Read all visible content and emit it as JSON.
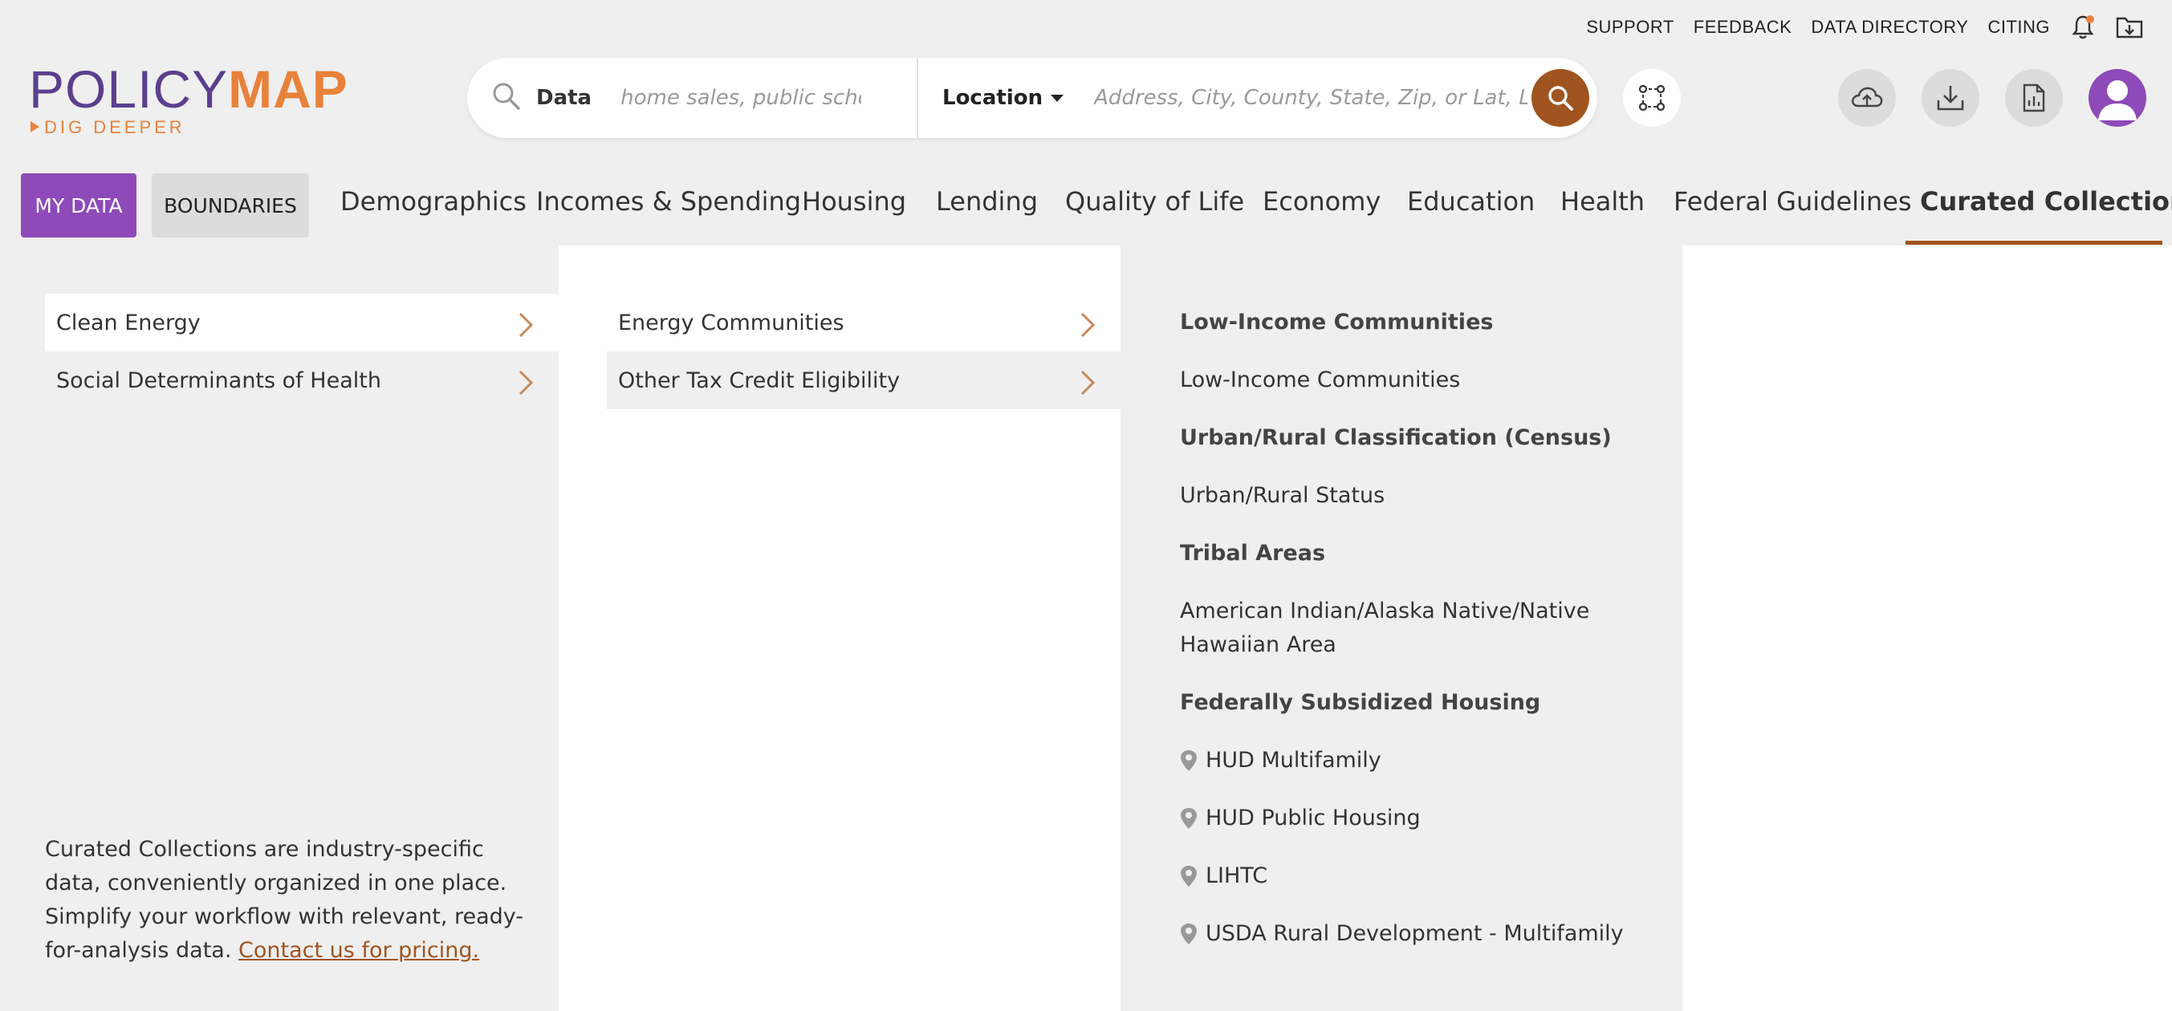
{
  "utility_links": [
    "SUPPORT",
    "FEEDBACK",
    "DATA DIRECTORY",
    "CITING"
  ],
  "logo": {
    "part1": "POLICY",
    "part2": "MAP",
    "tagline": "DIG DEEPER"
  },
  "search": {
    "data_label": "Data",
    "data_placeholder": "home sales, public school...",
    "location_label": "Location",
    "location_placeholder": "Address, City, County, State, Zip, or Lat, Long"
  },
  "nav": {
    "my_data": "MY DATA",
    "boundaries": "BOUNDARIES",
    "tabs": [
      "Demographics",
      "Incomes & Spending",
      "Housing",
      "Lending",
      "Quality of Life",
      "Economy",
      "Education",
      "Health",
      "Federal Guidelines",
      "Curated Collections"
    ],
    "active_tab": "Curated Collections"
  },
  "col1": {
    "items": [
      "Clean Energy",
      "Social Determinants of Health"
    ],
    "blurb": "Curated Collections are industry-specific data, conveniently organized in one place. Simplify your workflow with relevant, ready-for-analysis data.",
    "blurb_link": "Contact us for pricing."
  },
  "col2": {
    "items": [
      "Energy Communities",
      "Other Tax Credit Eligibility"
    ]
  },
  "col3": {
    "entries": [
      {
        "type": "heading",
        "text": "Low-Income Communities"
      },
      {
        "type": "link",
        "text": "Low-Income Communities"
      },
      {
        "type": "heading",
        "text": "Urban/Rural Classification (Census)"
      },
      {
        "type": "link",
        "text": "Urban/Rural Status"
      },
      {
        "type": "heading",
        "text": "Tribal Areas"
      },
      {
        "type": "link",
        "text": "American Indian/Alaska Native/Native Hawaiian Area"
      },
      {
        "type": "heading",
        "text": "Federally Subsidized Housing"
      },
      {
        "type": "point",
        "text": "HUD Multifamily"
      },
      {
        "type": "point",
        "text": "HUD Public Housing"
      },
      {
        "type": "point",
        "text": "LIHTC"
      },
      {
        "type": "point",
        "text": "USDA Rural Development - Multifamily"
      }
    ]
  },
  "colors": {
    "accent": "#a0541f",
    "purple": "#8e4ab8",
    "logo_purple": "#5b3f8e",
    "logo_orange": "#e8823b"
  }
}
